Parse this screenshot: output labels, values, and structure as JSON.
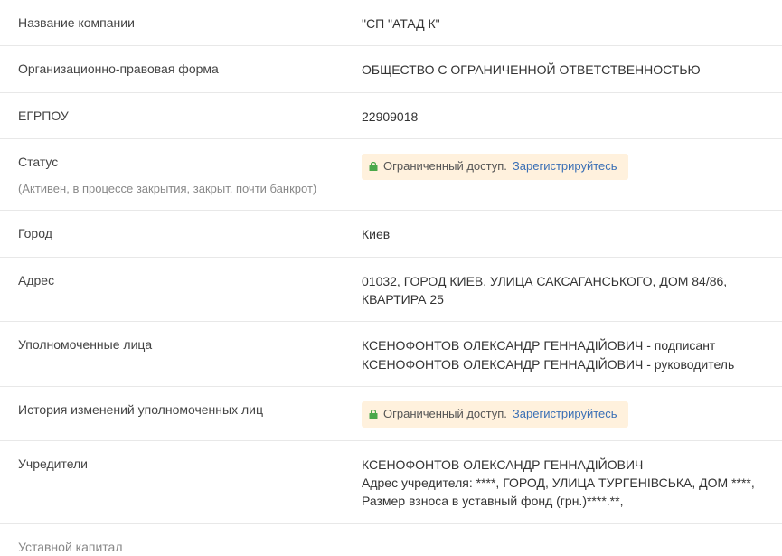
{
  "rows": [
    {
      "label": "Название компании",
      "value": "\"СП \"АТАД К\""
    },
    {
      "label": "Организационно-правовая форма",
      "value": "ОБЩЕСТВО С ОГРАНИЧЕННОЙ ОТВЕТСТВЕННОСТЬЮ"
    },
    {
      "label": "ЕГРПОУ",
      "value": "22909018"
    },
    {
      "label": "Статус",
      "sublabel": "(Активен, в процессе закрытия, закрыт, почти банкрот)",
      "restricted": {
        "text": "Ограниченный доступ.",
        "link": "Зарегистрируйтесь"
      }
    },
    {
      "label": "Город",
      "value": "Киев"
    },
    {
      "label": "Адрес",
      "value": "01032, ГОРОД КИЕВ, УЛИЦА САКСАГАНСЬКОГО, ДОМ 84/86, КВАРТИРА 25"
    },
    {
      "label": "Уполномоченные лица",
      "value": "КСЕНОФОНТОВ ОЛЕКСАНДР ГЕННАДІЙОВИЧ - подписант\nКСЕНОФОНТОВ ОЛЕКСАНДР ГЕННАДІЙОВИЧ - руководитель"
    },
    {
      "label": "История изменений уполномоченных лиц",
      "restricted": {
        "text": "Ограниченный доступ.",
        "link": "Зарегистрируйтесь"
      }
    },
    {
      "label": "Учредители",
      "value": "КСЕНОФОНТОВ ОЛЕКСАНДР ГЕННАДІЙОВИЧ\nАдрес учредителя: ****, ГОРОД, УЛИЦА ТУРГЕНІВСЬКА, ДОМ ****,\nРазмер взноса в уставный фонд (грн.)****.**,"
    }
  ],
  "partial_row_label": "Уставной капитал"
}
